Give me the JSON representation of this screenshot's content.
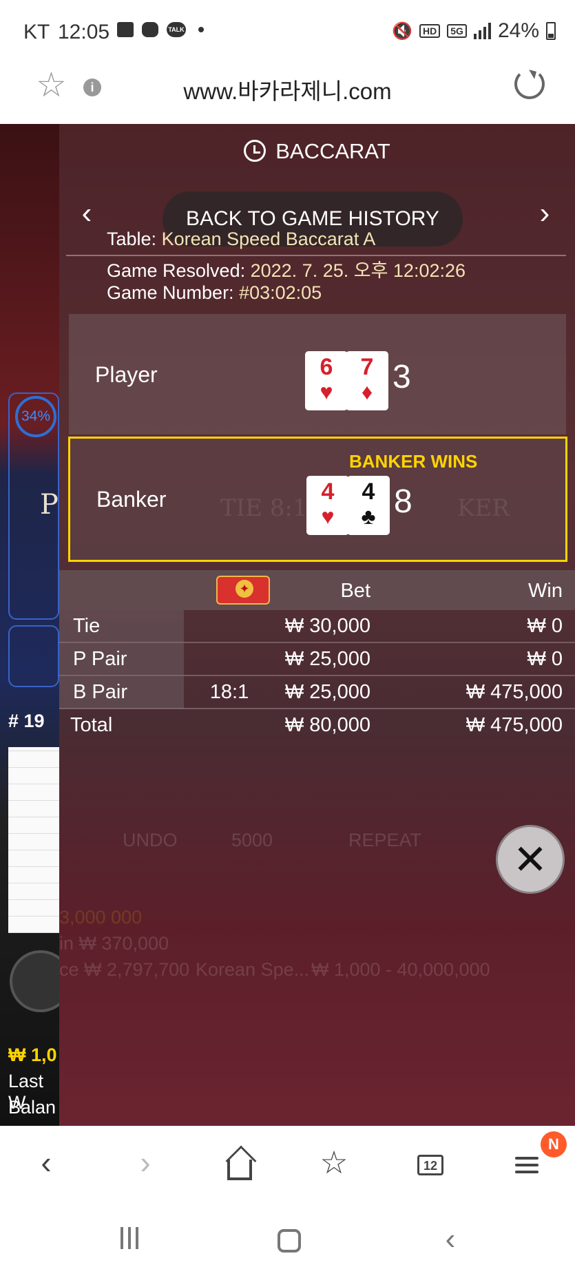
{
  "status_bar": {
    "carrier": "KT",
    "time": "12:05",
    "talk_icon": "TALK",
    "hd": "HD",
    "net": "5G",
    "battery": "24%"
  },
  "browser": {
    "url": "www.바카라제니.com"
  },
  "background": {
    "percent": "34%",
    "p_letter": "P",
    "round": "# 19",
    "win_amount": "₩ 1,0",
    "last_win": "Last W",
    "balance": "Balan",
    "ghost_win_rest": "3,000 000",
    "ghost_last_win": "in ₩ 370,000",
    "ghost_balance": "ce ₩ 2,797,700",
    "ghost_table": "Korean Spe...",
    "ghost_limits": "₩ 1,000 - 40,000,000",
    "ghost_undo": "UNDO",
    "ghost_chip": "5000",
    "ghost_repeat": "REPEAT",
    "ghost_tie": "TIE 8:1",
    "ghost_banker": "KER"
  },
  "panel": {
    "title": "BACCARAT",
    "back_label": "BACK TO GAME HISTORY",
    "prev_arrow": "‹",
    "next_arrow": "›",
    "meta": {
      "table_label": "Table:",
      "table_value": "Korean Speed Baccarat A",
      "resolved_label": "Game Resolved:",
      "resolved_value": "2022. 7. 25. 오후 12:02:26",
      "number_label": "Game Number:",
      "number_value": "#03:02:05"
    },
    "player": {
      "label": "Player",
      "cards": [
        {
          "rank": "6",
          "suit": "♥",
          "color": "#d6202b"
        },
        {
          "rank": "7",
          "suit": "♦",
          "color": "#d6202b"
        }
      ],
      "total": "3"
    },
    "banker": {
      "label": "Banker",
      "result": "BANKER WINS",
      "cards": [
        {
          "rank": "4",
          "suit": "♥",
          "color": "#d6202b"
        },
        {
          "rank": "4",
          "suit": "♣",
          "color": "#111111"
        }
      ],
      "total": "8"
    },
    "bets": {
      "header_bet": "Bet",
      "header_win": "Win",
      "rows": [
        {
          "label": "Tie",
          "odds": "",
          "bet": "₩ 30,000",
          "win": "₩ 0"
        },
        {
          "label": "P Pair",
          "odds": "",
          "bet": "₩ 25,000",
          "win": "₩ 0"
        },
        {
          "label": "B Pair",
          "odds": "18:1",
          "bet": "₩ 25,000",
          "win": "₩ 475,000"
        }
      ],
      "total": {
        "label": "Total",
        "bet": "₩ 80,000",
        "win": "₩ 475,000"
      }
    },
    "close_icon": "✕"
  },
  "toolbar": {
    "tab_count": "12",
    "menu_badge": "N"
  },
  "colors": {
    "accent_yellow": "#ffd400",
    "panel_bg": "#4d2328",
    "red_suit": "#d6202b",
    "badge": "#ff5a2a"
  }
}
